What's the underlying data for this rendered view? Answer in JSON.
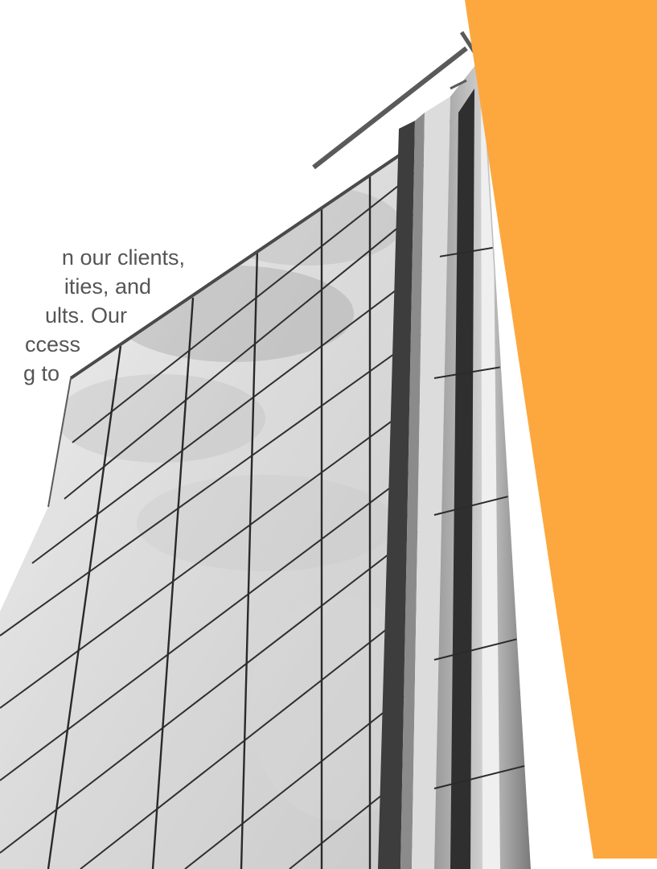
{
  "intro": {
    "lines": [
      "n our clients,",
      "ities, and",
      "ults. Our",
      "ccess",
      "g to"
    ]
  },
  "colors": {
    "accent": "#FCA83E",
    "sky": "#f7f7f7",
    "glass_light": "#e6e6e6",
    "glass_mid": "#bdbdbd",
    "glass_dark": "#3a3a3a",
    "mullion": "#2b2b2b",
    "text": "#555555"
  },
  "icons": {
    "building": "building-photo"
  }
}
